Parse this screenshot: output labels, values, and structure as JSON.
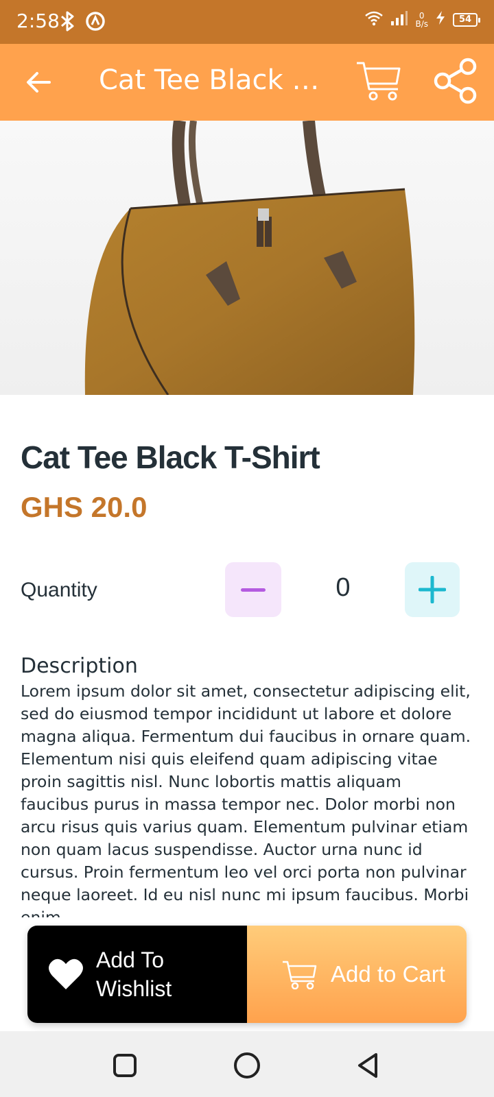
{
  "status_bar": {
    "time": "2:58",
    "net_speed_value": "0",
    "net_speed_unit": "B/s",
    "battery": "54",
    "icons": [
      "bluetooth-icon",
      "sync-icon",
      "wifi-icon",
      "signal-icon",
      "charging-icon"
    ]
  },
  "app_bar": {
    "title": "Cat Tee Black T...",
    "icons": [
      "back-arrow-icon",
      "cart-icon",
      "share-icon"
    ]
  },
  "product": {
    "name": "Cat Tee Black T-Shirt",
    "price": "GHS 20.0",
    "image": "leather-handbag"
  },
  "quantity": {
    "label": "Quantity",
    "value": "0"
  },
  "description": {
    "heading": "Description",
    "text": "Lorem ipsum dolor sit amet, consectetur adipiscing elit, sed do eiusmod tempor incididunt ut labore et dolore magna aliqua. Fermentum dui faucibus in ornare quam. Elementum nisi quis eleifend quam adipiscing vitae proin sagittis nisl. Nunc lobortis mattis aliquam faucibus purus in massa tempor nec. Dolor morbi non arcu risus quis varius quam. Elementum pulvinar etiam non quam lacus suspendisse. Auctor urna nunc id cursus. Proin fermentum leo vel orci porta non pulvinar neque laoreet. Id eu nisl nunc mi ipsum faucibus. Morbi enim"
  },
  "actions": {
    "wishlist_label": "Add To Wishlist",
    "cart_label": "Add to Cart"
  },
  "colors": {
    "status_bar": "#c4762a",
    "app_bar": "#ffa24d",
    "price": "#c4762a",
    "minus_bg": "#f5e6fb",
    "minus_fg": "#b45be0",
    "plus_bg": "#dff6f9",
    "plus_fg": "#1cb8cf"
  }
}
